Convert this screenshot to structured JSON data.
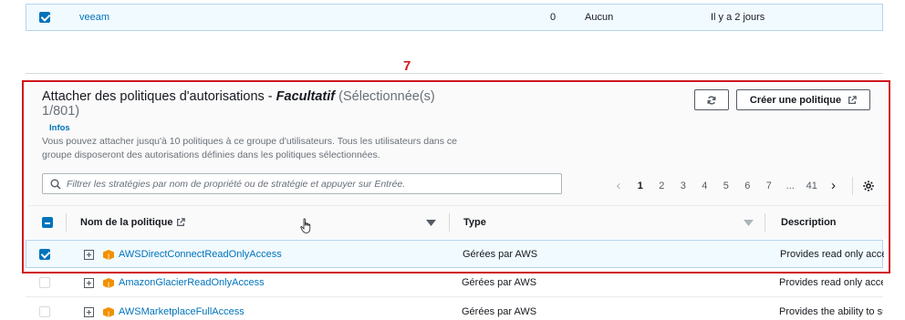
{
  "top_row": {
    "checked": true,
    "name": "veeam",
    "count": "0",
    "perm": "Aucun",
    "created": "Il y a 2 jours"
  },
  "annotation": {
    "number": "7",
    "color": "#d0161f"
  },
  "panel": {
    "title_main": "Attacher des politiques d'autorisations -",
    "title_optional": "Facultatif",
    "title_count": "(Sélectionnée(s) 1/801)",
    "infos": "Infos",
    "description": "Vous pouvez attacher jusqu'à 10 politiques à ce groupe d'utilisateurs. Tous les utilisateurs dans ce groupe disposeront des autorisations définies dans les politiques sélectionnées.",
    "refresh_icon": "refresh-icon",
    "create_label": "Créer une politique",
    "search_placeholder": "Filtrer les stratégies par nom de propriété ou de stratégie et appuyer sur Entrée.",
    "pagination": {
      "pages": [
        "1",
        "2",
        "3",
        "4",
        "5",
        "6",
        "7",
        "...",
        "41"
      ],
      "current": "1"
    },
    "columns": {
      "name": "Nom de la politique",
      "type": "Type",
      "description": "Description"
    }
  },
  "rows": [
    {
      "checked": true,
      "name": "AWSDirectConnectReadOnlyAccess",
      "type": "Gérées par AWS",
      "description": "Provides read only acce"
    },
    {
      "checked": false,
      "name": "AmazonGlacierReadOnlyAccess",
      "type": "Gérées par AWS",
      "description": "Provides read only acce"
    },
    {
      "checked": false,
      "name": "AWSMarketplaceFullAccess",
      "type": "Gérées par AWS",
      "description": "Provides the ability to su"
    }
  ],
  "colors": {
    "accent": "#0073bb",
    "selected_bg": "#f1faff",
    "annotation_red": "#d0161f",
    "aws_orange": "#f29100"
  }
}
